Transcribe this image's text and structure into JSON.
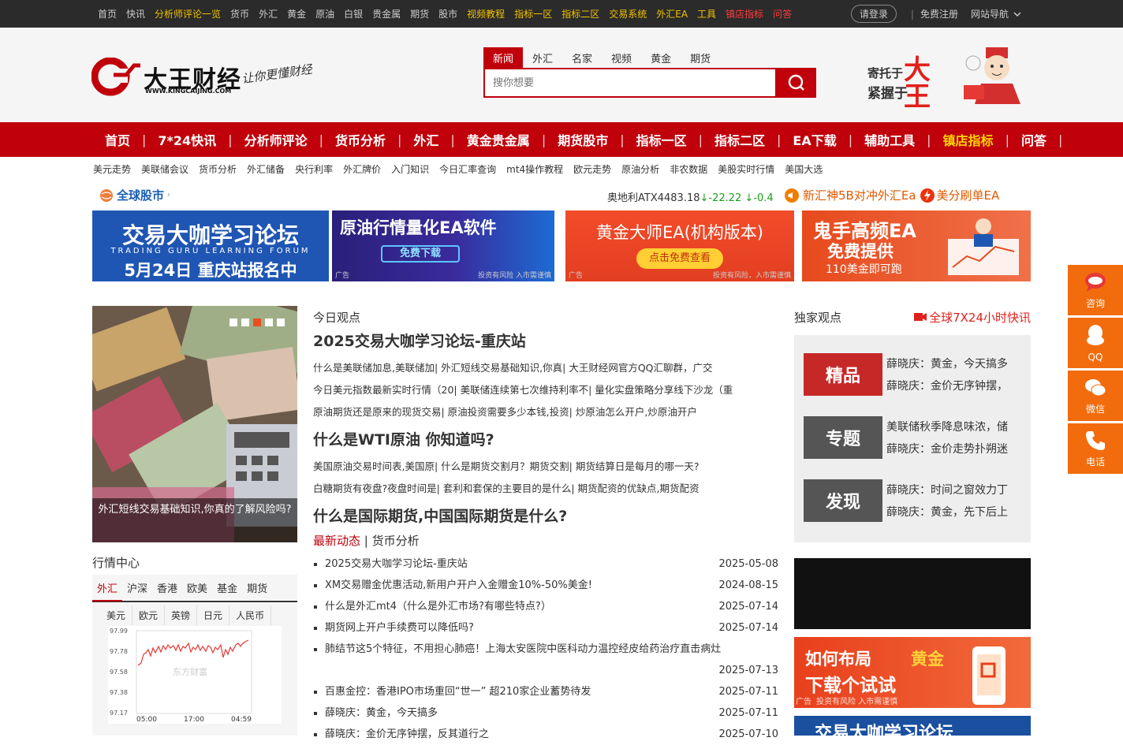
{
  "topnav": {
    "links": [
      {
        "label": "首页",
        "style": "n"
      },
      {
        "label": "快讯",
        "style": "n"
      },
      {
        "label": "分析师评论一览",
        "style": "y"
      },
      {
        "label": "货币",
        "style": "n"
      },
      {
        "label": "外汇",
        "style": "n"
      },
      {
        "label": "黄金",
        "style": "n"
      },
      {
        "label": "原油",
        "style": "n"
      },
      {
        "label": "白银",
        "style": "n"
      },
      {
        "label": "贵金属",
        "style": "n"
      },
      {
        "label": "期货",
        "style": "n"
      },
      {
        "label": "股市",
        "style": "n"
      },
      {
        "label": "视频教程",
        "style": "y"
      },
      {
        "label": "指标一区",
        "style": "y"
      },
      {
        "label": "指标二区",
        "style": "y"
      },
      {
        "label": "交易系统",
        "style": "y"
      },
      {
        "label": "外汇EA",
        "style": "y"
      },
      {
        "label": "工具",
        "style": "y"
      },
      {
        "label": "镇店指标",
        "style": "r"
      },
      {
        "label": "问答",
        "style": "r"
      }
    ],
    "login": "请登录",
    "register": "免费注册",
    "site_nav": "网站导航"
  },
  "header": {
    "logo_text": "大王财经",
    "logo_slogan": "让你更懂财经",
    "logo_url_text": "WWW.KINGCAIJING.COM",
    "brand_ad_line1": "寄托于",
    "brand_ad_line2": "紧握于",
    "brand_ad_big": "大王"
  },
  "search": {
    "tabs": [
      "新闻",
      "外汇",
      "名家",
      "视频",
      "黄金",
      "期货"
    ],
    "active_tab": 0,
    "placeholder": "搜你想要"
  },
  "mainnav": {
    "items": [
      {
        "label": "首页",
        "style": "w"
      },
      {
        "label": "7*24快讯",
        "style": "w"
      },
      {
        "label": "分析师评论",
        "style": "w"
      },
      {
        "label": "货币分析",
        "style": "w"
      },
      {
        "label": "外汇",
        "style": "w"
      },
      {
        "label": "黄金贵金属",
        "style": "w"
      },
      {
        "label": "期货股市",
        "style": "w"
      },
      {
        "label": "指标一区",
        "style": "w"
      },
      {
        "label": "指标二区",
        "style": "w"
      },
      {
        "label": "EA下载",
        "style": "w"
      },
      {
        "label": "辅助工具",
        "style": "w"
      },
      {
        "label": "镇店指标",
        "style": "y"
      },
      {
        "label": "问答",
        "style": "w"
      }
    ]
  },
  "subnav": [
    "美元走势",
    "美联储会议",
    "货币分析",
    "外汇储备",
    "央行利率",
    "外汇牌价",
    "入门知识",
    "今日汇率查询",
    "mt4操作教程",
    "欧元走势",
    "原油分析",
    "非农数据",
    "美股实时行情",
    "美国大选"
  ],
  "market": {
    "global_label": "全球股市",
    "ticker_name": "奥地利ATX4483.18",
    "ticker_change": "↓-22.22 ↓-0.4",
    "promo1": "新汇神5B对冲外汇Ea",
    "promo2": "美分刷单EA"
  },
  "banners": [
    {
      "line1": "交易大咖学习论坛",
      "line2": "TRADING GURU LEARNING FORUM",
      "line3": "5月24日 重庆站报名中"
    },
    {
      "line1": "原油行情量化EA软件",
      "btn": "免费下载",
      "ad": "广告",
      "risk": "投资有风险 入市需谨慎"
    },
    {
      "line1": "黄金大师EA(机构版本)",
      "btn": "点击免费查看",
      "ad": "广告",
      "risk": "投资有风险，入市需谨慎"
    },
    {
      "line1": "鬼手高频EA",
      "line2": "免费提供",
      "line3": "110美金即可跑"
    }
  ],
  "carousel": {
    "caption": "外汇短线交易基础知识,你真的了解风险吗?",
    "dots": 5,
    "active_dot": 2
  },
  "today": {
    "section": "今日观点",
    "headline1": "2025交易大咖学习论坛-重庆站",
    "links1": [
      "什么是美联储加息,美联储加| 外汇短线交易基础知识,你真| 大王财经网官方QQ汇聊群，广交",
      "今日美元指数最新实时行情（20| 美联储连续第七次维持利率不| 量化实盘策略分享线下沙龙（重",
      "原油期货还是原来的现货交易| 原油投资需要多少本钱,投资| 炒原油怎么开户,炒原油开户"
    ],
    "headline2": "什么是WTI原油 你知道吗?",
    "links2": [
      "美国原油交易时间表,美国原| 什么是期货交割月？期货交割| 期货结算日是每月的哪一天?",
      "白糖期货有夜盘?夜盘时间是| 套利和套保的主要目的是什么| 期货配资的优缺点,期货配资"
    ],
    "headline3": "什么是国际期货,中国国际期货是什么?",
    "news_tab1": "最新动态",
    "news_tab2": "货币分析",
    "news": [
      {
        "title": "2025交易大咖学习论坛-重庆站",
        "date": "2025-05-08"
      },
      {
        "title": "XM交易赠金优惠活动,新用户开户入金赠金10%-50%美金!",
        "date": "2024-08-15"
      },
      {
        "title": "什么是外汇mt4（什么是外汇市场?有哪些特点?）",
        "date": "2025-07-14"
      },
      {
        "title": "期货网上开户手续费可以降低吗?",
        "date": "2025-07-14"
      },
      {
        "title": "肺结节这5个特征，不用担心肺癌！上海太安医院中医科动力温控经皮给药治疗直击病灶",
        "date": "2025-07-13"
      },
      {
        "title": "百惠金控：香港IPO市场重回“世一” 超210家企业蓄势待发",
        "date": "2025-07-11"
      },
      {
        "title": "薛晓庆：黄金，今天搞多",
        "date": "2025-07-11"
      },
      {
        "title": "薛晓庆：金价无序钟摆，反其道行之",
        "date": "2025-07-10"
      }
    ]
  },
  "exclusive": {
    "section": "独家观点",
    "live_link": "全球7X24小时快讯",
    "rows": [
      {
        "tag": "精品",
        "color": "#c62828",
        "lines": [
          "薛晓庆：黄金，今天搞多",
          "薛晓庆：金价无序钟摆，"
        ]
      },
      {
        "tag": "专题",
        "color": "#555555",
        "lines": [
          "美联储秋季降息味浓，储",
          "薛晓庆：金价走势扑朔迷"
        ]
      },
      {
        "tag": "发现",
        "color": "#555555",
        "lines": [
          "薛晓庆：时间之窗效力丁",
          "薛晓庆：黄金，先下后上"
        ]
      }
    ]
  },
  "gold_ad": {
    "line1": "如何布局",
    "line1b": "黄金",
    "line2": "下载个试试",
    "ad": "广告",
    "risk": "投资有风险 入市需谨慎"
  },
  "bottom_ad": {
    "line1": "交易大咖学习论坛"
  },
  "market_center": {
    "section": "行情中心",
    "tabs": [
      "外汇",
      "沪深",
      "香港",
      "欧美",
      "基金",
      "期货"
    ],
    "active_tab": 0,
    "currencies": [
      "美元",
      "欧元",
      "英镑",
      "日元",
      "人民币"
    ],
    "watermark": "东方财富",
    "chart": {
      "y_ticks": [
        "97.99",
        "97.78",
        "97.58",
        "97.38",
        "97.17"
      ],
      "x_ticks": [
        "05:00",
        "17:00",
        "04:59"
      ]
    }
  },
  "side_float": [
    "咨询",
    "QQ",
    "微信",
    "电话"
  ],
  "colors": {
    "brand_red": "#c0000b",
    "top_bg": "#2b2b2b",
    "float_orange": "#f26c0d"
  }
}
